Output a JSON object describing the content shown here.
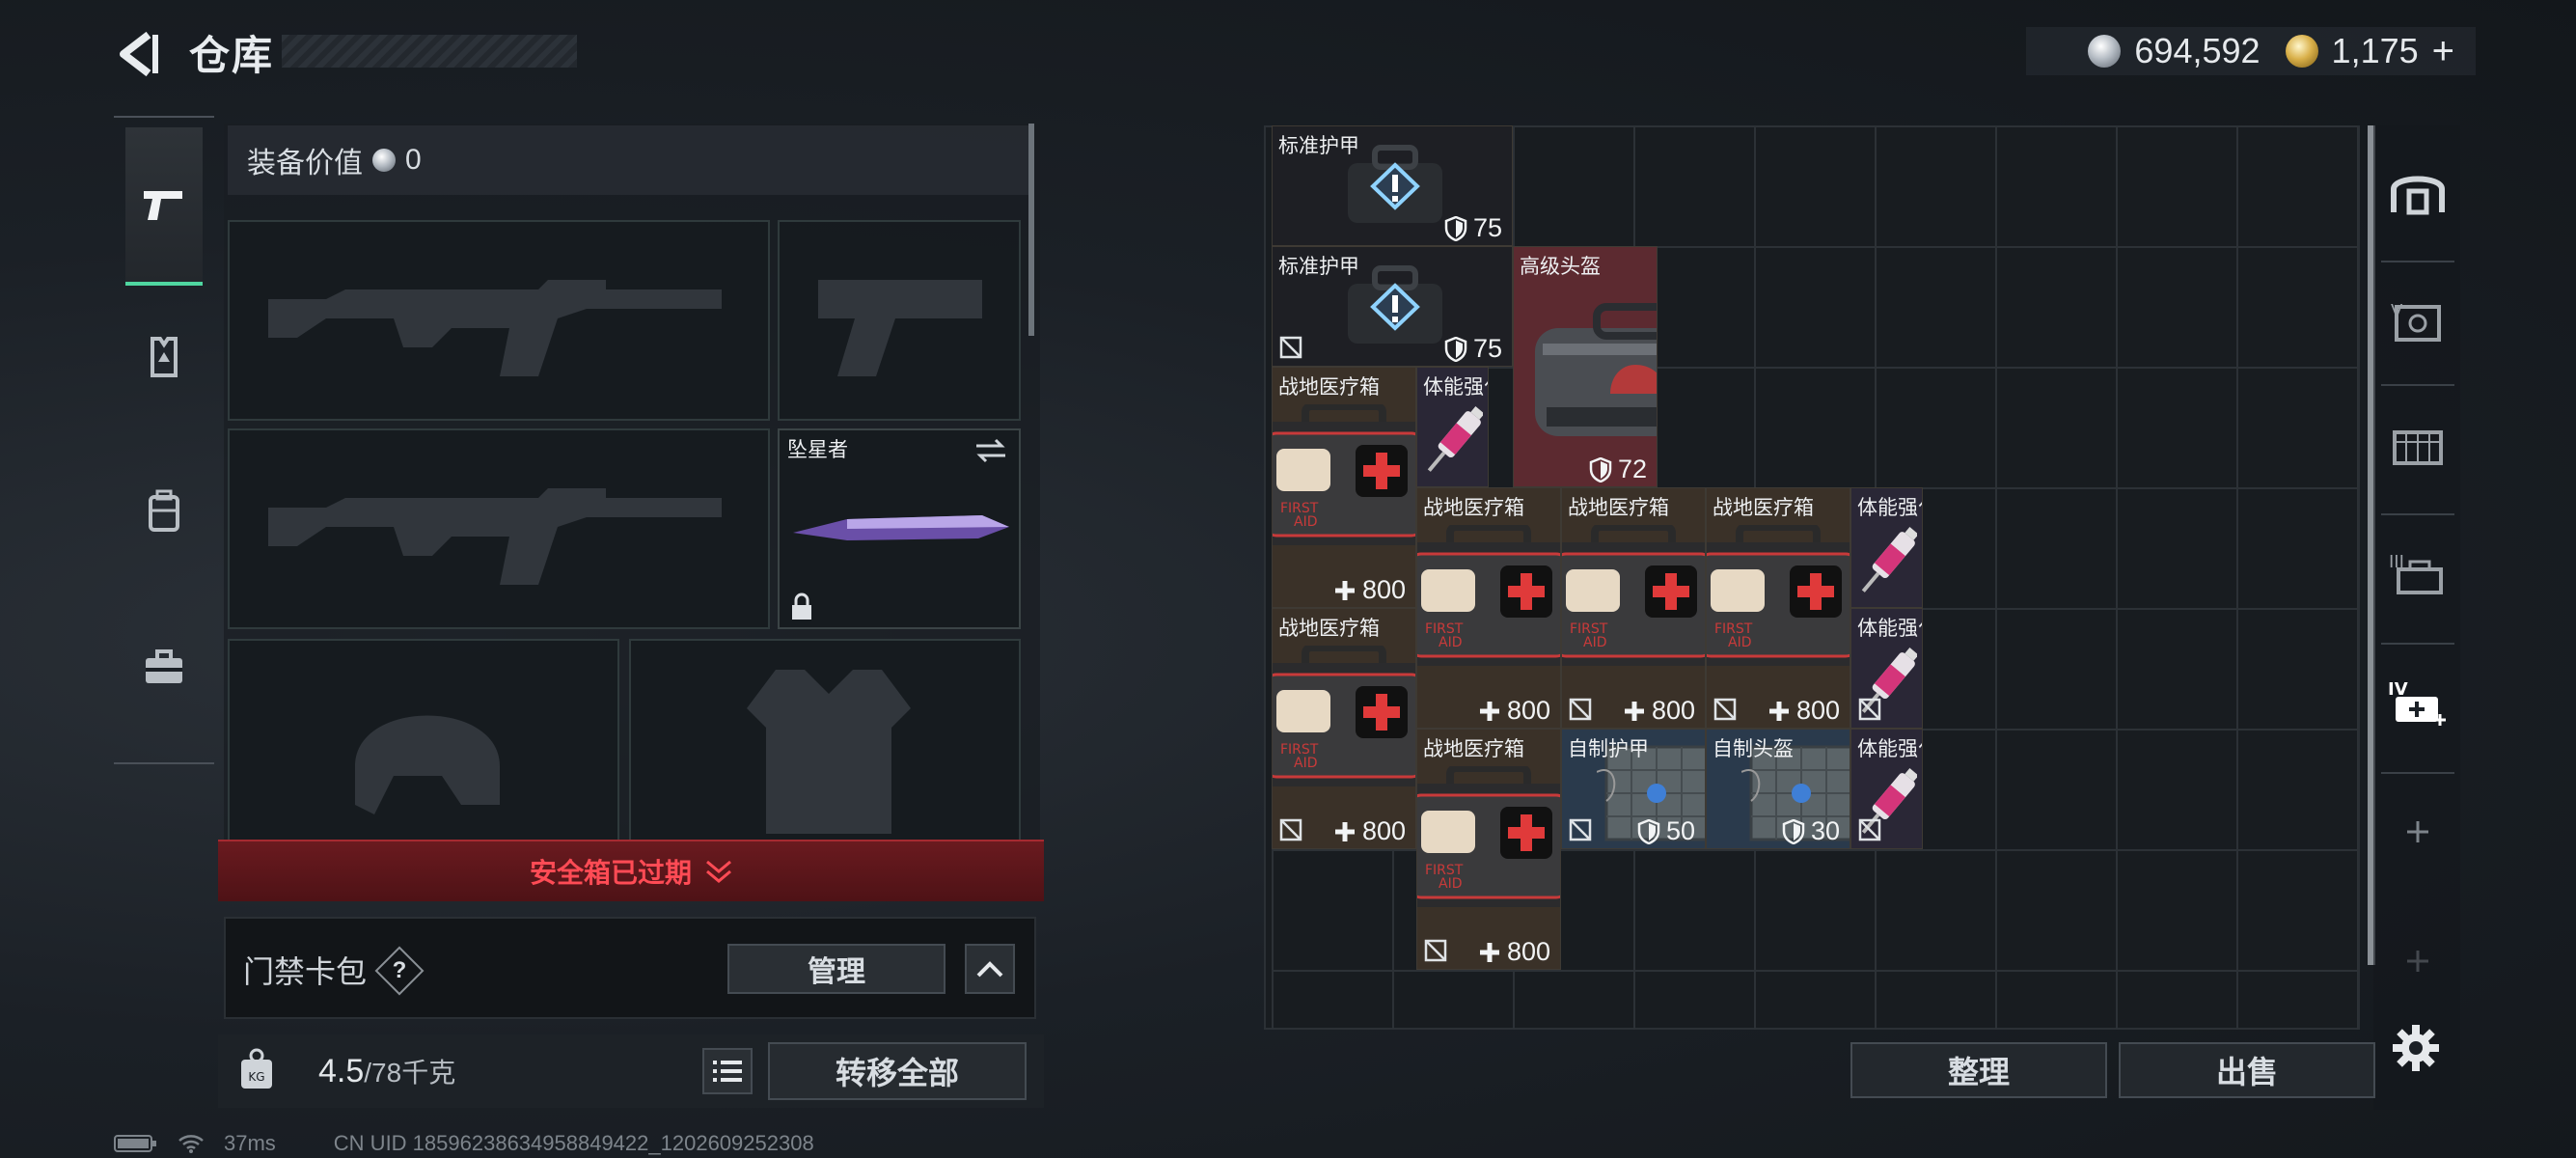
{
  "header": {
    "title": "仓库",
    "silver": "694,592",
    "gold": "1,175",
    "gold_add": "+"
  },
  "equipment": {
    "value_label": "装备价值",
    "value": "0",
    "knife_name": "坠星者"
  },
  "safebox": {
    "expired_label": "安全箱已过期"
  },
  "keycard": {
    "label": "门禁卡包",
    "help": "?",
    "manage_label": "管理"
  },
  "weight": {
    "current": "4.5",
    "max": "/78千克"
  },
  "actions": {
    "transfer_all": "转移全部",
    "sort": "整理",
    "sell": "出售"
  },
  "status": {
    "ping": "37ms",
    "uid": "CN UID 18596238634958849422_1202609252308"
  },
  "items": [
    {
      "name": "标准护甲",
      "value": "75",
      "stat": "armor"
    },
    {
      "name": "标准护甲",
      "value": "75",
      "stat": "armor"
    },
    {
      "name": "高级头盔",
      "value": "72",
      "stat": "armor"
    },
    {
      "name": "战地医疗箱",
      "value": "800",
      "stat": "heal"
    },
    {
      "name": "体能强化剂",
      "value": "",
      "stat": ""
    },
    {
      "name": "战地医疗箱",
      "value": "800",
      "stat": "heal"
    },
    {
      "name": "战地医疗箱",
      "value": "800",
      "stat": "heal"
    },
    {
      "name": "战地医疗箱",
      "value": "800",
      "stat": "heal"
    },
    {
      "name": "体能强化剂",
      "value": "",
      "stat": ""
    },
    {
      "name": "战地医疗箱",
      "value": "800",
      "stat": "heal"
    },
    {
      "name": "体能强化剂",
      "value": "",
      "stat": ""
    },
    {
      "name": "战地医疗箱",
      "value": "800",
      "stat": "heal"
    },
    {
      "name": "自制护甲",
      "value": "50",
      "stat": "armor"
    },
    {
      "name": "自制头盔",
      "value": "30",
      "stat": "armor"
    },
    {
      "name": "体能强化剂",
      "value": "",
      "stat": ""
    }
  ],
  "rail": {
    "tier3": "III",
    "tier4": "IV"
  },
  "icons": {
    "accent": "#4fd6a0",
    "danger": "#ff4b55"
  }
}
